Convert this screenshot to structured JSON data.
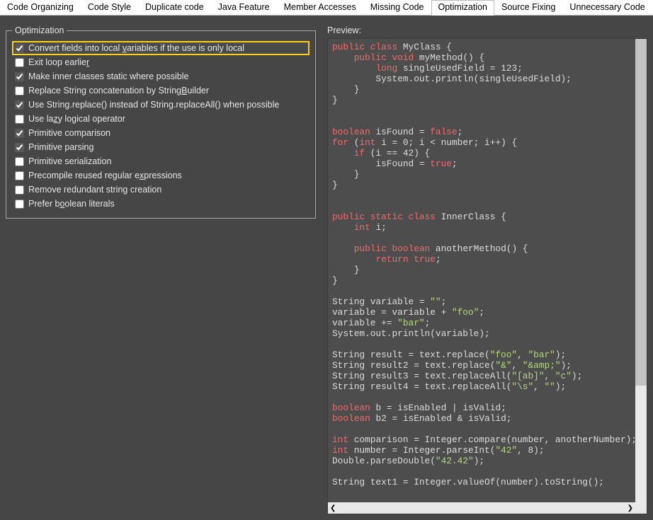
{
  "tabs": [
    {
      "label": "Code Organizing"
    },
    {
      "label": "Code Style"
    },
    {
      "label": "Duplicate code"
    },
    {
      "label": "Java Feature"
    },
    {
      "label": "Member Accesses"
    },
    {
      "label": "Missing Code"
    },
    {
      "label": "Optimization"
    },
    {
      "label": "Source Fixing"
    },
    {
      "label": "Unnecessary Code"
    }
  ],
  "active_tab_index": 6,
  "opt": {
    "legend": "Optimization",
    "items": [
      {
        "checked": true,
        "highlight": true,
        "pre": "Convert fields into local ",
        "uch": "v",
        "post": "ariables if the use is only local"
      },
      {
        "checked": false,
        "highlight": false,
        "pre": "Exit loop earlie",
        "uch": "r",
        "post": ""
      },
      {
        "checked": true,
        "highlight": false,
        "pre": "Make inner classes static where possible",
        "uch": "",
        "post": ""
      },
      {
        "checked": false,
        "highlight": false,
        "pre": "Replace String concatenation by String",
        "uch": "B",
        "post": "uilder"
      },
      {
        "checked": true,
        "highlight": false,
        "pre": "Use String.replace() instead of String.replaceAll() when possible",
        "uch": "",
        "post": ""
      },
      {
        "checked": false,
        "highlight": false,
        "pre": "Use la",
        "uch": "z",
        "post": "y logical operator"
      },
      {
        "checked": true,
        "highlight": false,
        "pre": "Primitive comparison",
        "uch": "",
        "post": ""
      },
      {
        "checked": true,
        "highlight": false,
        "pre": "Primitive parsin",
        "uch": "g",
        "post": ""
      },
      {
        "checked": false,
        "highlight": false,
        "pre": "Primitive serialization",
        "uch": "",
        "post": ""
      },
      {
        "checked": false,
        "highlight": false,
        "pre": "Precompile reused regular e",
        "uch": "x",
        "post": "pressions"
      },
      {
        "checked": false,
        "highlight": false,
        "pre": "Remove redundant string creation",
        "uch": "",
        "post": ""
      },
      {
        "checked": false,
        "highlight": false,
        "pre": "Prefer b",
        "uch": "o",
        "post": "olean literals"
      }
    ]
  },
  "preview": {
    "label": "Preview:",
    "tokens": [
      [
        [
          "k",
          "public"
        ],
        [
          "p",
          " "
        ],
        [
          "k",
          "class"
        ],
        [
          "p",
          " MyClass {"
        ]
      ],
      [
        [
          "p",
          "    "
        ],
        [
          "k",
          "public"
        ],
        [
          "p",
          " "
        ],
        [
          "k",
          "void"
        ],
        [
          "p",
          " myMethod() {"
        ]
      ],
      [
        [
          "p",
          "        "
        ],
        [
          "k",
          "long"
        ],
        [
          "p",
          " singleUsedField = 123;"
        ]
      ],
      [
        [
          "p",
          "        System.out.println(singleUsedField);"
        ]
      ],
      [
        [
          "p",
          "    }"
        ]
      ],
      [
        [
          "p",
          "}"
        ]
      ],
      [],
      [],
      [
        [
          "k",
          "boolean"
        ],
        [
          "p",
          " isFound = "
        ],
        [
          "k",
          "false"
        ],
        [
          "p",
          ";"
        ]
      ],
      [
        [
          "k",
          "for"
        ],
        [
          "p",
          " ("
        ],
        [
          "k",
          "int"
        ],
        [
          "p",
          " i = 0; i < number; i++) {"
        ]
      ],
      [
        [
          "p",
          "    "
        ],
        [
          "k",
          "if"
        ],
        [
          "p",
          " (i == 42) {"
        ]
      ],
      [
        [
          "p",
          "        isFound = "
        ],
        [
          "k",
          "true"
        ],
        [
          "p",
          ";"
        ]
      ],
      [
        [
          "p",
          "    }"
        ]
      ],
      [
        [
          "p",
          "}"
        ]
      ],
      [],
      [],
      [
        [
          "k",
          "public"
        ],
        [
          "p",
          " "
        ],
        [
          "k",
          "static"
        ],
        [
          "p",
          " "
        ],
        [
          "k",
          "class"
        ],
        [
          "p",
          " InnerClass {"
        ]
      ],
      [
        [
          "p",
          "    "
        ],
        [
          "k",
          "int"
        ],
        [
          "p",
          " i;"
        ]
      ],
      [],
      [
        [
          "p",
          "    "
        ],
        [
          "k",
          "public"
        ],
        [
          "p",
          " "
        ],
        [
          "k",
          "boolean"
        ],
        [
          "p",
          " anotherMethod() {"
        ]
      ],
      [
        [
          "p",
          "        "
        ],
        [
          "k",
          "return"
        ],
        [
          "p",
          " "
        ],
        [
          "k",
          "true"
        ],
        [
          "p",
          ";"
        ]
      ],
      [
        [
          "p",
          "    }"
        ]
      ],
      [
        [
          "p",
          "}"
        ]
      ],
      [],
      [
        [
          "p",
          "String variable = "
        ],
        [
          "s",
          "\"\""
        ],
        [
          "p",
          ";"
        ]
      ],
      [
        [
          "p",
          "variable = variable + "
        ],
        [
          "s",
          "\"foo\""
        ],
        [
          "p",
          ";"
        ]
      ],
      [
        [
          "p",
          "variable += "
        ],
        [
          "s",
          "\"bar\""
        ],
        [
          "p",
          ";"
        ]
      ],
      [
        [
          "p",
          "System.out.println(variable);"
        ]
      ],
      [],
      [
        [
          "p",
          "String result = text.replace("
        ],
        [
          "s",
          "\"foo\""
        ],
        [
          "p",
          ", "
        ],
        [
          "s",
          "\"bar\""
        ],
        [
          "p",
          ");"
        ]
      ],
      [
        [
          "p",
          "String result2 = text.replace("
        ],
        [
          "s",
          "\"&\""
        ],
        [
          "p",
          ", "
        ],
        [
          "s",
          "\"&amp;\""
        ],
        [
          "p",
          ");"
        ]
      ],
      [
        [
          "p",
          "String result3 = text.replaceAll("
        ],
        [
          "s",
          "\"[ab]\""
        ],
        [
          "p",
          ", "
        ],
        [
          "s",
          "\"c\""
        ],
        [
          "p",
          ");"
        ]
      ],
      [
        [
          "p",
          "String result4 = text.replaceAll("
        ],
        [
          "s",
          "\"\\s\""
        ],
        [
          "p",
          ", "
        ],
        [
          "s",
          "\"\""
        ],
        [
          "p",
          ");"
        ]
      ],
      [],
      [
        [
          "k",
          "boolean"
        ],
        [
          "p",
          " b = isEnabled | isValid;"
        ]
      ],
      [
        [
          "k",
          "boolean"
        ],
        [
          "p",
          " b2 = isEnabled & isValid;"
        ]
      ],
      [],
      [
        [
          "k",
          "int"
        ],
        [
          "p",
          " comparison = Integer.compare(number, anotherNumber);"
        ]
      ],
      [
        [
          "k",
          "int"
        ],
        [
          "p",
          " number = Integer.parseInt("
        ],
        [
          "s",
          "\"42\""
        ],
        [
          "p",
          ", 8);"
        ]
      ],
      [
        [
          "p",
          "Double.parseDouble("
        ],
        [
          "s",
          "\"42.42\""
        ],
        [
          "p",
          ");"
        ]
      ],
      [],
      [
        [
          "p",
          "String text1 = Integer.valueOf(number).toString();"
        ]
      ]
    ]
  }
}
